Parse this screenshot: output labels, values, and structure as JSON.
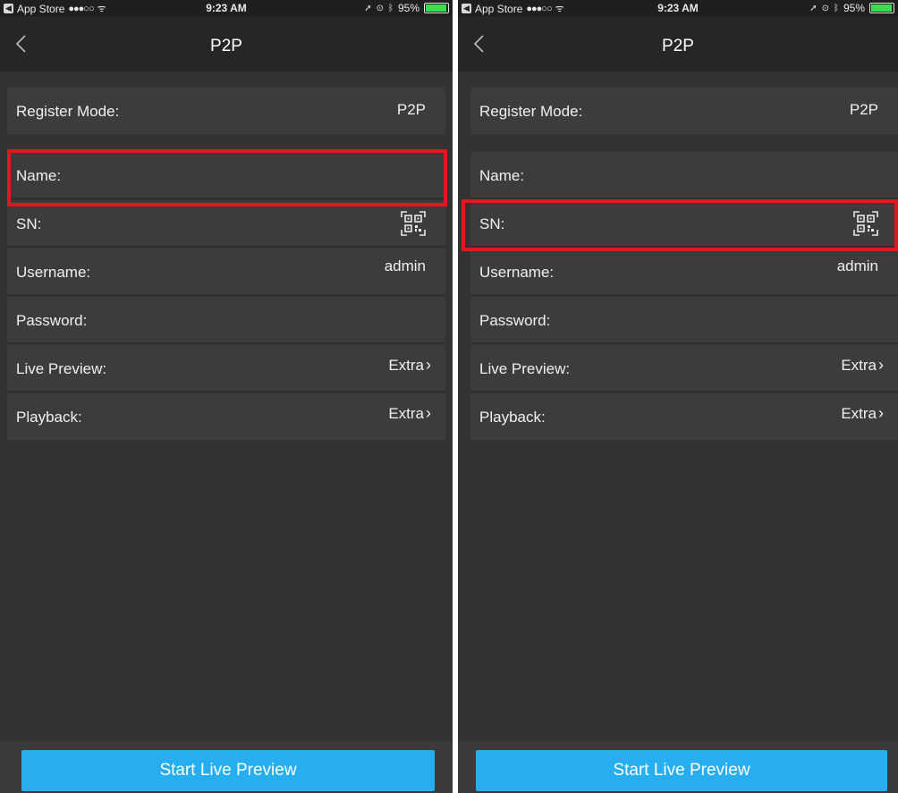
{
  "status": {
    "back_app": "App Store",
    "carrier_dots": "●●●○○",
    "wifi": "ᯤ",
    "time": "9:23 AM",
    "battery": "95%"
  },
  "screens": [
    {
      "title": "P2P",
      "register_mode": {
        "label": "Register Mode:",
        "value": "P2P"
      },
      "name": {
        "label": "Name:"
      },
      "sn": {
        "label": "SN:",
        "icon": "qr-code-scan-icon"
      },
      "username": {
        "label": "Username:",
        "value": "admin"
      },
      "password": {
        "label": "Password:"
      },
      "live_preview": {
        "label": "Live Preview:",
        "value": "Extra"
      },
      "playback": {
        "label": "Playback:",
        "value": "Extra"
      },
      "button": "Start Live Preview",
      "highlighted_field": "Name"
    },
    {
      "title": "P2P",
      "register_mode": {
        "label": "Register Mode:",
        "value": "P2P"
      },
      "name": {
        "label": "Name:"
      },
      "sn": {
        "label": "SN:",
        "icon": "qr-code-scan-icon"
      },
      "username": {
        "label": "Username:",
        "value": "admin"
      },
      "password": {
        "label": "Password:"
      },
      "live_preview": {
        "label": "Live Preview:",
        "value": "Extra"
      },
      "playback": {
        "label": "Playback:",
        "value": "Extra"
      },
      "button": "Start Live Preview",
      "highlighted_field": "SN"
    }
  ],
  "colors": {
    "background": "#333333",
    "navbar": "#262626",
    "row": "#3c3c3c",
    "accent_button": "#27aef0",
    "highlight": "#e0191f"
  }
}
